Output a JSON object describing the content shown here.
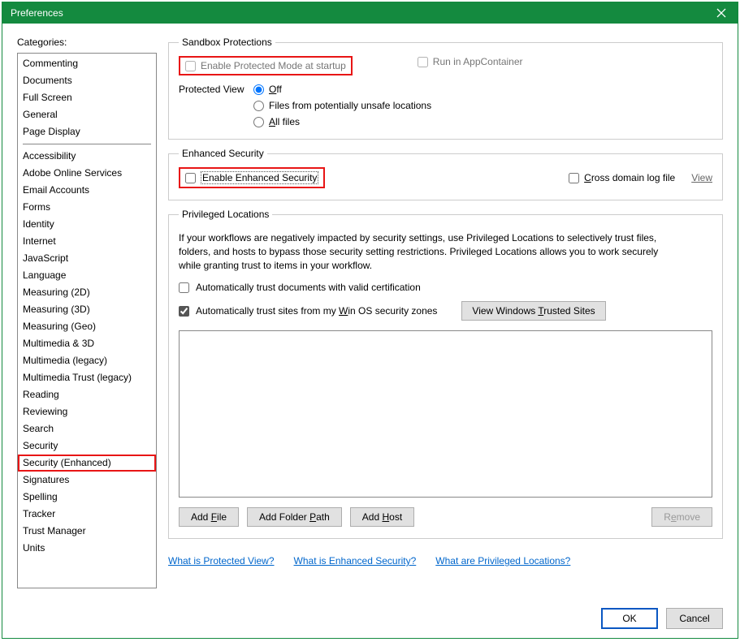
{
  "window": {
    "title": "Preferences"
  },
  "sidebar": {
    "label": "Categories:",
    "group1": [
      "Commenting",
      "Documents",
      "Full Screen",
      "General",
      "Page Display"
    ],
    "group2": [
      "Accessibility",
      "Adobe Online Services",
      "Email Accounts",
      "Forms",
      "Identity",
      "Internet",
      "JavaScript",
      "Language",
      "Measuring (2D)",
      "Measuring (3D)",
      "Measuring (Geo)",
      "Multimedia & 3D",
      "Multimedia (legacy)",
      "Multimedia Trust (legacy)",
      "Reading",
      "Reviewing",
      "Search",
      "Security",
      "Security (Enhanced)",
      "Signatures",
      "Spelling",
      "Tracker",
      "Trust Manager",
      "Units"
    ],
    "selected": "Security (Enhanced)"
  },
  "sandbox": {
    "legend": "Sandbox Protections",
    "enable_protected": "Enable Protected Mode at startup",
    "run_appcontainer": "Run in AppContainer",
    "protected_view_label": "Protected View",
    "radios": {
      "off": "Off",
      "unsafe": "Files from potentially unsafe locations",
      "all": "All files"
    }
  },
  "enhanced": {
    "legend": "Enhanced Security",
    "enable": "Enable Enhanced Security",
    "cross_domain": "Cross domain log file",
    "view": "View"
  },
  "privileged": {
    "legend": "Privileged Locations",
    "desc": "If your workflows are negatively impacted by security settings, use Privileged Locations to selectively trust files, folders, and hosts to bypass those security setting restrictions. Privileged Locations allows you to work securely while granting trust to items in your workflow.",
    "auto_trust_cert": "Automatically trust documents with valid certification",
    "auto_trust_sites": "Automatically trust sites from my Win OS security zones",
    "view_trusted_btn": "View Windows Trusted Sites",
    "add_file": "Add File",
    "add_folder": "Add Folder Path",
    "add_host": "Add Host",
    "remove": "Remove"
  },
  "links": {
    "protected": "What is Protected View?",
    "enhanced": "What is Enhanced Security?",
    "privileged": "What are Privileged Locations?"
  },
  "footer": {
    "ok": "OK",
    "cancel": "Cancel"
  }
}
